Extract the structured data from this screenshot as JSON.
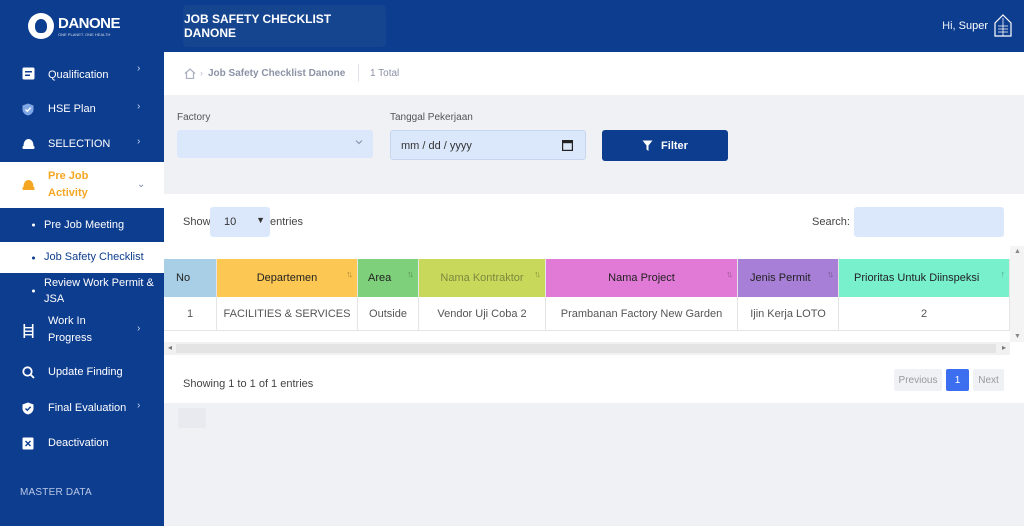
{
  "brand": {
    "name": "DANONE",
    "tagline": "ONE PLANET. ONE HEALTH"
  },
  "header": {
    "title": "JOB SAFETY CHECKLIST DANONE",
    "greeting": "Hi,",
    "username": "Super"
  },
  "sidebar": {
    "items": [
      {
        "label": "Qualification",
        "icon": "clipboard-icon",
        "has_chevron": true
      },
      {
        "label": "HSE Plan",
        "icon": "shield-check-icon",
        "has_chevron": true
      },
      {
        "label": "SELECTION",
        "icon": "helmet-icon",
        "has_chevron": true
      },
      {
        "label": "Pre Job Activity",
        "icon": "helmet-icon",
        "has_chevron": true,
        "active": true
      }
    ],
    "subitems": [
      {
        "label": "Pre Job Meeting"
      },
      {
        "label": "Job Safety Checklist",
        "current": true
      },
      {
        "label": "Review Work Permit & JSA"
      }
    ],
    "items2": [
      {
        "label": "Work In Progress",
        "icon": "ladder-icon",
        "has_chevron": true
      },
      {
        "label": "Update Finding",
        "icon": "search-icon",
        "has_chevron": false
      },
      {
        "label": "Final Evaluation",
        "icon": "check-shield-icon",
        "has_chevron": true
      },
      {
        "label": "Deactivation",
        "icon": "x-box-icon",
        "has_chevron": false
      }
    ],
    "section_label": "MASTER DATA"
  },
  "breadcrumb": {
    "title": "Job Safety Checklist Danone",
    "count": "1 Total"
  },
  "filters": {
    "factory_label": "Factory",
    "factory_value": "",
    "date_label": "Tanggal Pekerjaan",
    "date_placeholder": "mm / dd / yyyy",
    "filter_button": "Filter"
  },
  "table_controls": {
    "show_label": "Show",
    "page_length": "10",
    "entries_label": "entries",
    "search_label": "Search:"
  },
  "table": {
    "columns": [
      {
        "label": "No",
        "color": "#a8cfe6"
      },
      {
        "label": "Departemen",
        "color": "#fcc752"
      },
      {
        "label": "Area",
        "color": "#7ed07a"
      },
      {
        "label": "Nama Kontraktor",
        "color": "#c8d85a"
      },
      {
        "label": "Nama Project",
        "color": "#e07ad6"
      },
      {
        "label": "Jenis Permit",
        "color": "#a77fd6"
      },
      {
        "label": "Prioritas Untuk Diinspeksi",
        "color": "#78f0cc"
      }
    ],
    "rows": [
      [
        "1",
        "FACILITIES & SERVICES",
        "Outside",
        "Vendor Uji Coba 2",
        "Prambanan Factory New Garden",
        "Ijin Kerja LOTO",
        "2"
      ]
    ]
  },
  "footer": {
    "info": "Showing 1 to 1 of 1 entries",
    "previous": "Previous",
    "current_page": "1",
    "next": "Next"
  },
  "colors": {
    "primary": "#0d3d8f",
    "accent": "#f5a623",
    "field": "#dbe8fb",
    "page_active": "#3b6ff0"
  }
}
